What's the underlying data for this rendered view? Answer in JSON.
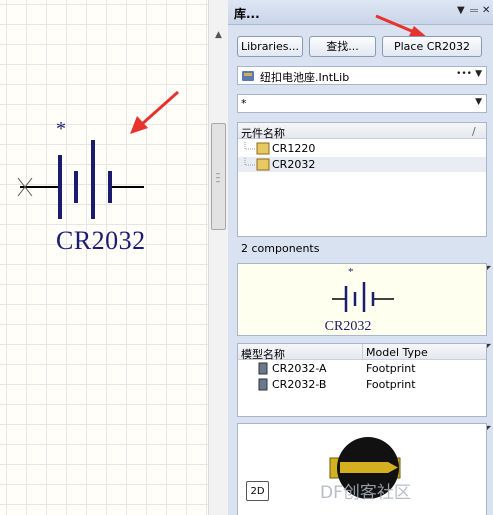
{
  "panel": {
    "title": "库...",
    "pin_icon": "pin-icon",
    "close_icon": "close-icon"
  },
  "toolbar": {
    "libraries_label": "Libraries...",
    "search_label": "查找...",
    "place_label": "Place CR2032"
  },
  "library_select": {
    "value": "纽扣电池座.IntLib",
    "more_icon": "ellipsis-icon"
  },
  "filter": {
    "value": "*"
  },
  "components": {
    "column_header": "元件名称",
    "sort_indicator": "/",
    "items": [
      {
        "name": "CR1220",
        "selected": false
      },
      {
        "name": "CR2032",
        "selected": true
      }
    ],
    "count_label": "2 components"
  },
  "symbol": {
    "designator_mark": "*",
    "name": "CR2032"
  },
  "models": {
    "header_name": "模型名称",
    "header_type": "Model Type",
    "items": [
      {
        "name": "CR2032-A",
        "type": "Footprint"
      },
      {
        "name": "CR2032-B",
        "type": "Footprint"
      }
    ]
  },
  "footprint_view": {
    "mode_label": "2D",
    "watermark": "DF创客社区"
  },
  "colors": {
    "symbol_blue": "#1c1c6e",
    "arrow_red": "#e8322e",
    "panel_bg": "#d9e2f0",
    "preview_bg": "#fffff0"
  }
}
